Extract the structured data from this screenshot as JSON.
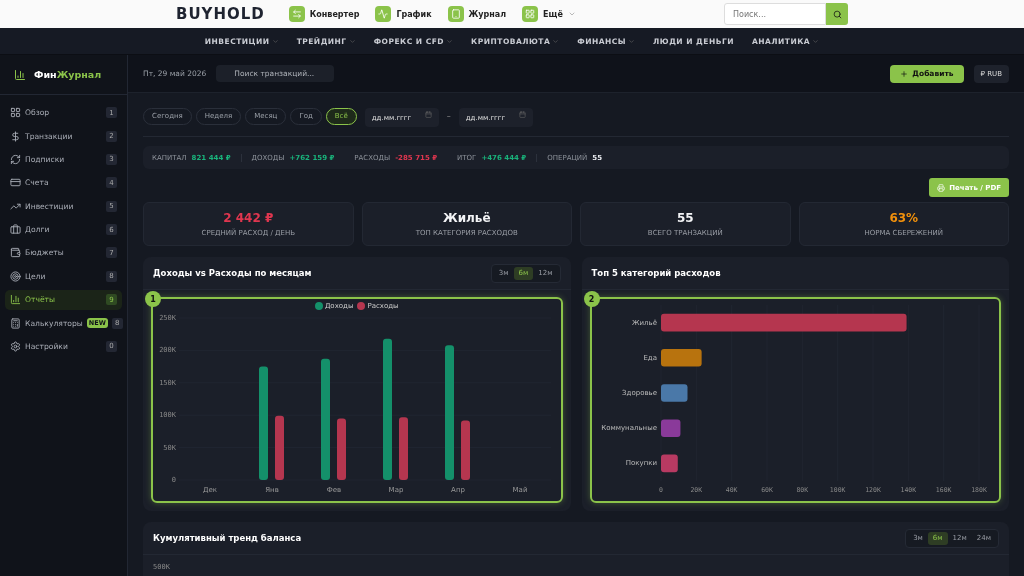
{
  "topbar": {
    "logo": "BUYHOLD",
    "links": [
      {
        "label": "Конвертер",
        "dropdown": false
      },
      {
        "label": "График",
        "dropdown": false
      },
      {
        "label": "Журнал",
        "dropdown": false
      },
      {
        "label": "Ещё",
        "dropdown": true
      }
    ],
    "search": {
      "placeholder": "Поиск..."
    }
  },
  "nav": [
    {
      "label": "ИНВЕСТИЦИИ",
      "dropdown": true
    },
    {
      "label": "ТРЕЙДИНГ",
      "dropdown": true
    },
    {
      "label": "ФОРЕКС И CFD",
      "dropdown": true
    },
    {
      "label": "КРИПТОВАЛЮТА",
      "dropdown": true
    },
    {
      "label": "ФИНАНСЫ",
      "dropdown": true
    },
    {
      "label": "ЛЮДИ И ДЕНЬГИ",
      "dropdown": false
    },
    {
      "label": "АНАЛИТИКА",
      "dropdown": true
    }
  ],
  "sidebar": {
    "brand_a": "Фин",
    "brand_b": "Журнал",
    "items": [
      {
        "label": "Обзор",
        "count": "1",
        "selected": false
      },
      {
        "label": "Транзакции",
        "count": "2",
        "selected": false
      },
      {
        "label": "Подписки",
        "count": "3",
        "selected": false
      },
      {
        "label": "Счета",
        "count": "4",
        "selected": false
      },
      {
        "label": "Инвестиции",
        "count": "5",
        "selected": false
      },
      {
        "label": "Долги",
        "count": "6",
        "selected": false
      },
      {
        "label": "Бюджеты",
        "count": "7",
        "selected": false
      },
      {
        "label": "Цели",
        "count": "8",
        "selected": false
      },
      {
        "label": "Отчёты",
        "count": "9",
        "selected": true
      },
      {
        "label": "Калькуляторы",
        "count": "8",
        "badge": "NEW",
        "selected": false
      },
      {
        "label": "Настройки",
        "count": "0",
        "selected": false
      }
    ]
  },
  "header": {
    "date": "Пт, 29 май 2026",
    "search_placeholder": "Поиск транзакций...",
    "add_button": "Добавить",
    "currency_button": "₽ RUB"
  },
  "periods": [
    {
      "label": "Сегодня",
      "selected": false
    },
    {
      "label": "Неделя",
      "selected": false
    },
    {
      "label": "Месяц",
      "selected": false
    },
    {
      "label": "Год",
      "selected": false
    },
    {
      "label": "Всё",
      "selected": true
    }
  ],
  "date_range": {
    "from_placeholder": "дд.мм.гггг",
    "separator": "–",
    "to_placeholder": "дд.мм.гггг"
  },
  "summary": [
    {
      "label": "КАПИТАЛ",
      "value": "821 444 ₽",
      "color": "#19b37b"
    },
    {
      "label": "ДОХОДЫ",
      "value": "+762 159 ₽",
      "color": "#19b37b"
    },
    {
      "label": "РАСХОДЫ",
      "value": "-285 715 ₽",
      "color": "#e0364f"
    },
    {
      "label": "ИТОГ",
      "value": "+476 444 ₽",
      "color": "#19b37b"
    },
    {
      "label": "ОПЕРАЦИЙ",
      "value": "55",
      "color": "#e8eaee"
    }
  ],
  "print_button": "Печать / PDF",
  "stats": [
    {
      "value": "2 442 ₽",
      "label": "СРЕДНИЙ РАСХОД / ДЕНЬ",
      "color": "#e0364f"
    },
    {
      "value": "Жильё",
      "label": "ТОП КАТЕГОРИЯ РАСХОДОВ",
      "color": "#f2f3f5"
    },
    {
      "value": "55",
      "label": "ВСЕГО ТРАНЗАКЦИЙ",
      "color": "#f2f3f5"
    },
    {
      "value": "63%",
      "label": "НОРМА СБЕРЕЖЕНИЙ",
      "color": "#f0900c"
    }
  ],
  "income_chart": {
    "title": "Доходы vs Расходы по месяцам",
    "marker": "1",
    "ranges": [
      {
        "label": "3м",
        "selected": false
      },
      {
        "label": "6м",
        "selected": true
      },
      {
        "label": "12м",
        "selected": false
      }
    ],
    "chart_data": {
      "type": "bar",
      "grid": true,
      "categories": [
        "Дек",
        "Янв",
        "Фев",
        "Мар",
        "Апр",
        "Май"
      ],
      "series": [
        {
          "name": "Доходы",
          "color": "#14906a",
          "values": [
            null,
            175000,
            187000,
            218000,
            208000,
            null
          ]
        },
        {
          "name": "Расходы",
          "color": "#b5364f",
          "values": [
            null,
            99000,
            95000,
            97000,
            92000,
            null
          ]
        }
      ],
      "ylim": [
        0,
        250000
      ],
      "yticks": [
        {
          "value": 0,
          "label": "0"
        },
        {
          "value": 50000,
          "label": "50K"
        },
        {
          "value": 100000,
          "label": "100K"
        },
        {
          "value": 150000,
          "label": "150K"
        },
        {
          "value": 200000,
          "label": "200K"
        },
        {
          "value": 250000,
          "label": "250K"
        }
      ]
    }
  },
  "category_chart": {
    "title": "Топ 5 категорий расходов",
    "marker": "2",
    "chart_data": {
      "type": "bar",
      "orientation": "horizontal",
      "grid": true,
      "categories": [
        "Жильё",
        "Еда",
        "Здоровье",
        "Коммунальные",
        "Покупки"
      ],
      "series": [
        {
          "values": [
            139000,
            23000,
            15000,
            11000,
            9500
          ]
        }
      ],
      "colors": [
        "#b5364f",
        "#b8730e",
        "#4a78a8",
        "#8a3a9a",
        "#b83a62"
      ],
      "xlim": [
        0,
        180000
      ],
      "xticks": [
        {
          "value": 0,
          "label": "0"
        },
        {
          "value": 20000,
          "label": "20K"
        },
        {
          "value": 40000,
          "label": "40K"
        },
        {
          "value": 60000,
          "label": "60K"
        },
        {
          "value": 80000,
          "label": "80K"
        },
        {
          "value": 100000,
          "label": "100K"
        },
        {
          "value": 120000,
          "label": "120K"
        },
        {
          "value": 140000,
          "label": "140K"
        },
        {
          "value": 160000,
          "label": "160K"
        },
        {
          "value": 180000,
          "label": "180K"
        }
      ]
    }
  },
  "trend_chart": {
    "title": "Кумулятивный тренд баланса",
    "ranges": [
      {
        "label": "3м",
        "selected": false
      },
      {
        "label": "6м",
        "selected": true
      },
      {
        "label": "12м",
        "selected": false
      },
      {
        "label": "24м",
        "selected": false
      }
    ],
    "axis_label": "500K"
  }
}
